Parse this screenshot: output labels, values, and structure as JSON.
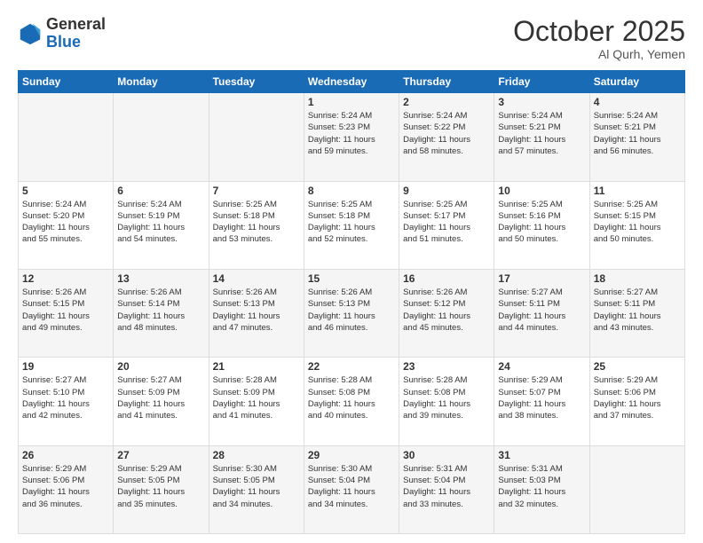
{
  "header": {
    "logo_general": "General",
    "logo_blue": "Blue",
    "month": "October 2025",
    "location": "Al Qurh, Yemen"
  },
  "weekdays": [
    "Sunday",
    "Monday",
    "Tuesday",
    "Wednesday",
    "Thursday",
    "Friday",
    "Saturday"
  ],
  "weeks": [
    [
      {
        "day": "",
        "info": ""
      },
      {
        "day": "",
        "info": ""
      },
      {
        "day": "",
        "info": ""
      },
      {
        "day": "1",
        "info": "Sunrise: 5:24 AM\nSunset: 5:23 PM\nDaylight: 11 hours\nand 59 minutes."
      },
      {
        "day": "2",
        "info": "Sunrise: 5:24 AM\nSunset: 5:22 PM\nDaylight: 11 hours\nand 58 minutes."
      },
      {
        "day": "3",
        "info": "Sunrise: 5:24 AM\nSunset: 5:21 PM\nDaylight: 11 hours\nand 57 minutes."
      },
      {
        "day": "4",
        "info": "Sunrise: 5:24 AM\nSunset: 5:21 PM\nDaylight: 11 hours\nand 56 minutes."
      }
    ],
    [
      {
        "day": "5",
        "info": "Sunrise: 5:24 AM\nSunset: 5:20 PM\nDaylight: 11 hours\nand 55 minutes."
      },
      {
        "day": "6",
        "info": "Sunrise: 5:24 AM\nSunset: 5:19 PM\nDaylight: 11 hours\nand 54 minutes."
      },
      {
        "day": "7",
        "info": "Sunrise: 5:25 AM\nSunset: 5:18 PM\nDaylight: 11 hours\nand 53 minutes."
      },
      {
        "day": "8",
        "info": "Sunrise: 5:25 AM\nSunset: 5:18 PM\nDaylight: 11 hours\nand 52 minutes."
      },
      {
        "day": "9",
        "info": "Sunrise: 5:25 AM\nSunset: 5:17 PM\nDaylight: 11 hours\nand 51 minutes."
      },
      {
        "day": "10",
        "info": "Sunrise: 5:25 AM\nSunset: 5:16 PM\nDaylight: 11 hours\nand 50 minutes."
      },
      {
        "day": "11",
        "info": "Sunrise: 5:25 AM\nSunset: 5:15 PM\nDaylight: 11 hours\nand 50 minutes."
      }
    ],
    [
      {
        "day": "12",
        "info": "Sunrise: 5:26 AM\nSunset: 5:15 PM\nDaylight: 11 hours\nand 49 minutes."
      },
      {
        "day": "13",
        "info": "Sunrise: 5:26 AM\nSunset: 5:14 PM\nDaylight: 11 hours\nand 48 minutes."
      },
      {
        "day": "14",
        "info": "Sunrise: 5:26 AM\nSunset: 5:13 PM\nDaylight: 11 hours\nand 47 minutes."
      },
      {
        "day": "15",
        "info": "Sunrise: 5:26 AM\nSunset: 5:13 PM\nDaylight: 11 hours\nand 46 minutes."
      },
      {
        "day": "16",
        "info": "Sunrise: 5:26 AM\nSunset: 5:12 PM\nDaylight: 11 hours\nand 45 minutes."
      },
      {
        "day": "17",
        "info": "Sunrise: 5:27 AM\nSunset: 5:11 PM\nDaylight: 11 hours\nand 44 minutes."
      },
      {
        "day": "18",
        "info": "Sunrise: 5:27 AM\nSunset: 5:11 PM\nDaylight: 11 hours\nand 43 minutes."
      }
    ],
    [
      {
        "day": "19",
        "info": "Sunrise: 5:27 AM\nSunset: 5:10 PM\nDaylight: 11 hours\nand 42 minutes."
      },
      {
        "day": "20",
        "info": "Sunrise: 5:27 AM\nSunset: 5:09 PM\nDaylight: 11 hours\nand 41 minutes."
      },
      {
        "day": "21",
        "info": "Sunrise: 5:28 AM\nSunset: 5:09 PM\nDaylight: 11 hours\nand 41 minutes."
      },
      {
        "day": "22",
        "info": "Sunrise: 5:28 AM\nSunset: 5:08 PM\nDaylight: 11 hours\nand 40 minutes."
      },
      {
        "day": "23",
        "info": "Sunrise: 5:28 AM\nSunset: 5:08 PM\nDaylight: 11 hours\nand 39 minutes."
      },
      {
        "day": "24",
        "info": "Sunrise: 5:29 AM\nSunset: 5:07 PM\nDaylight: 11 hours\nand 38 minutes."
      },
      {
        "day": "25",
        "info": "Sunrise: 5:29 AM\nSunset: 5:06 PM\nDaylight: 11 hours\nand 37 minutes."
      }
    ],
    [
      {
        "day": "26",
        "info": "Sunrise: 5:29 AM\nSunset: 5:06 PM\nDaylight: 11 hours\nand 36 minutes."
      },
      {
        "day": "27",
        "info": "Sunrise: 5:29 AM\nSunset: 5:05 PM\nDaylight: 11 hours\nand 35 minutes."
      },
      {
        "day": "28",
        "info": "Sunrise: 5:30 AM\nSunset: 5:05 PM\nDaylight: 11 hours\nand 34 minutes."
      },
      {
        "day": "29",
        "info": "Sunrise: 5:30 AM\nSunset: 5:04 PM\nDaylight: 11 hours\nand 34 minutes."
      },
      {
        "day": "30",
        "info": "Sunrise: 5:31 AM\nSunset: 5:04 PM\nDaylight: 11 hours\nand 33 minutes."
      },
      {
        "day": "31",
        "info": "Sunrise: 5:31 AM\nSunset: 5:03 PM\nDaylight: 11 hours\nand 32 minutes."
      },
      {
        "day": "",
        "info": ""
      }
    ]
  ]
}
